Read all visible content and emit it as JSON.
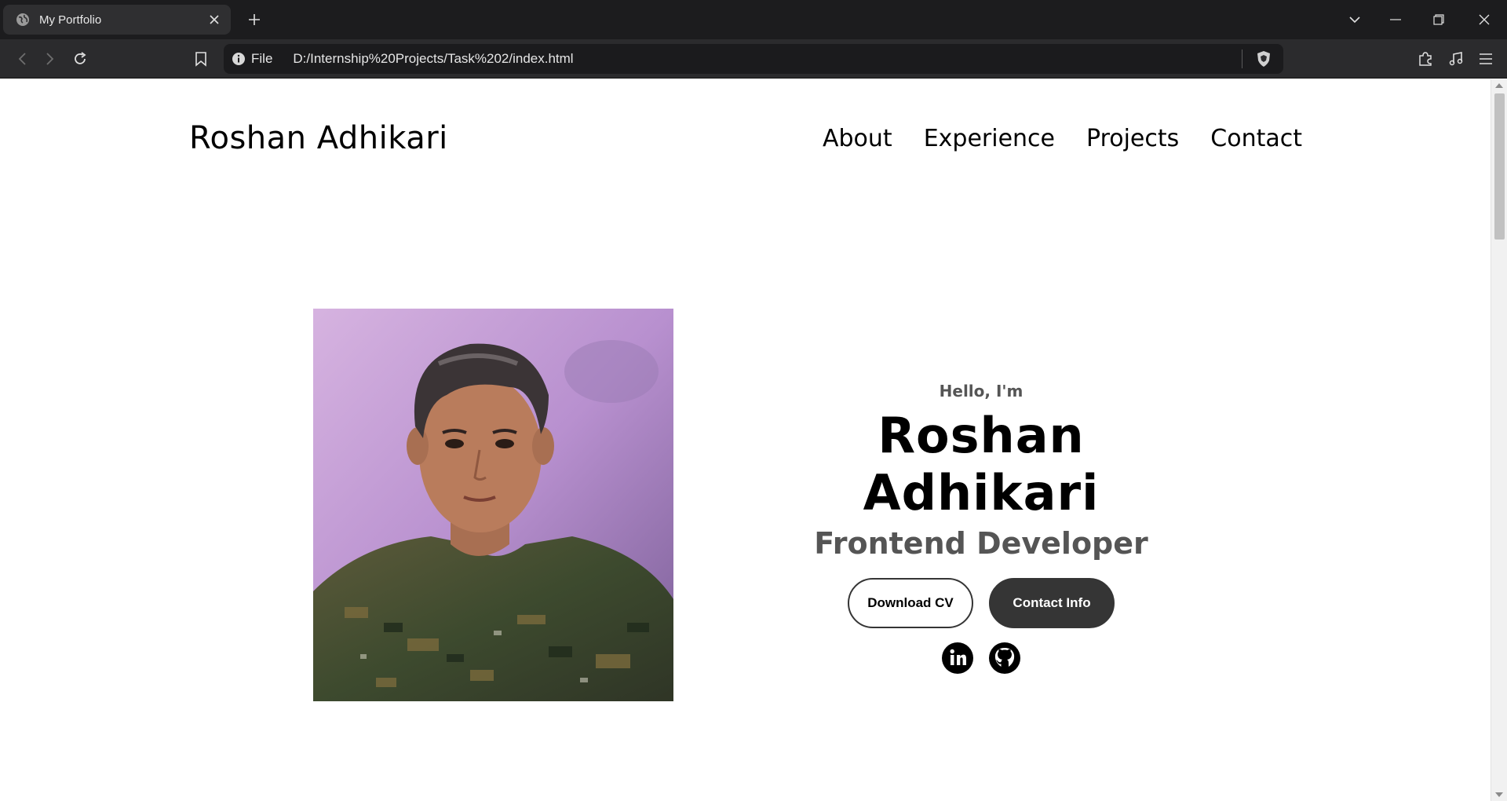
{
  "browser": {
    "tab_title": "My Portfolio",
    "address_scheme": "File",
    "url": "D:/Internship%20Projects/Task%202/index.html"
  },
  "page": {
    "logo": "Roshan Adhikari",
    "nav": [
      "About",
      "Experience",
      "Projects",
      "Contact"
    ],
    "hero": {
      "greeting": "Hello, I'm",
      "name": "Roshan Adhikari",
      "role": "Frontend Developer",
      "download_cv_label": "Download CV",
      "contact_info_label": "Contact Info"
    },
    "socials": [
      "linkedin-icon",
      "github-icon"
    ]
  },
  "colors": {
    "chrome_dark": "#1c1c1e",
    "button_dark": "#353535",
    "subtitle_gray": "#555555"
  }
}
